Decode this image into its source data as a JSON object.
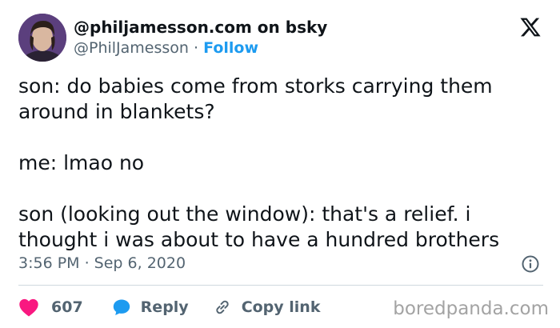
{
  "author": {
    "display_name": "@philjamesson.com on bsky",
    "handle": "@PhilJamesson",
    "separator": "·",
    "follow_label": "Follow"
  },
  "tweet": {
    "lines": [
      "son: do babies come from storks carrying them",
      "around in blankets?",
      "me: lmao no",
      "son (looking out the window): that's a relief. i",
      "thought i was about to have a hundred brothers"
    ],
    "timestamp": "3:56 PM · Sep 6, 2020"
  },
  "actions": {
    "like_count": "607",
    "reply_label": "Reply",
    "copy_link_label": "Copy link"
  },
  "watermark": "boredpanda.com",
  "icons": {
    "platform": "x-logo-icon",
    "info": "info-icon",
    "like": "heart-icon",
    "reply": "speech-bubble-icon",
    "copy": "link-icon"
  },
  "colors": {
    "accent": "#1d9bf0",
    "like": "#f91880",
    "text": "#0f1419",
    "secondary": "#536471"
  }
}
